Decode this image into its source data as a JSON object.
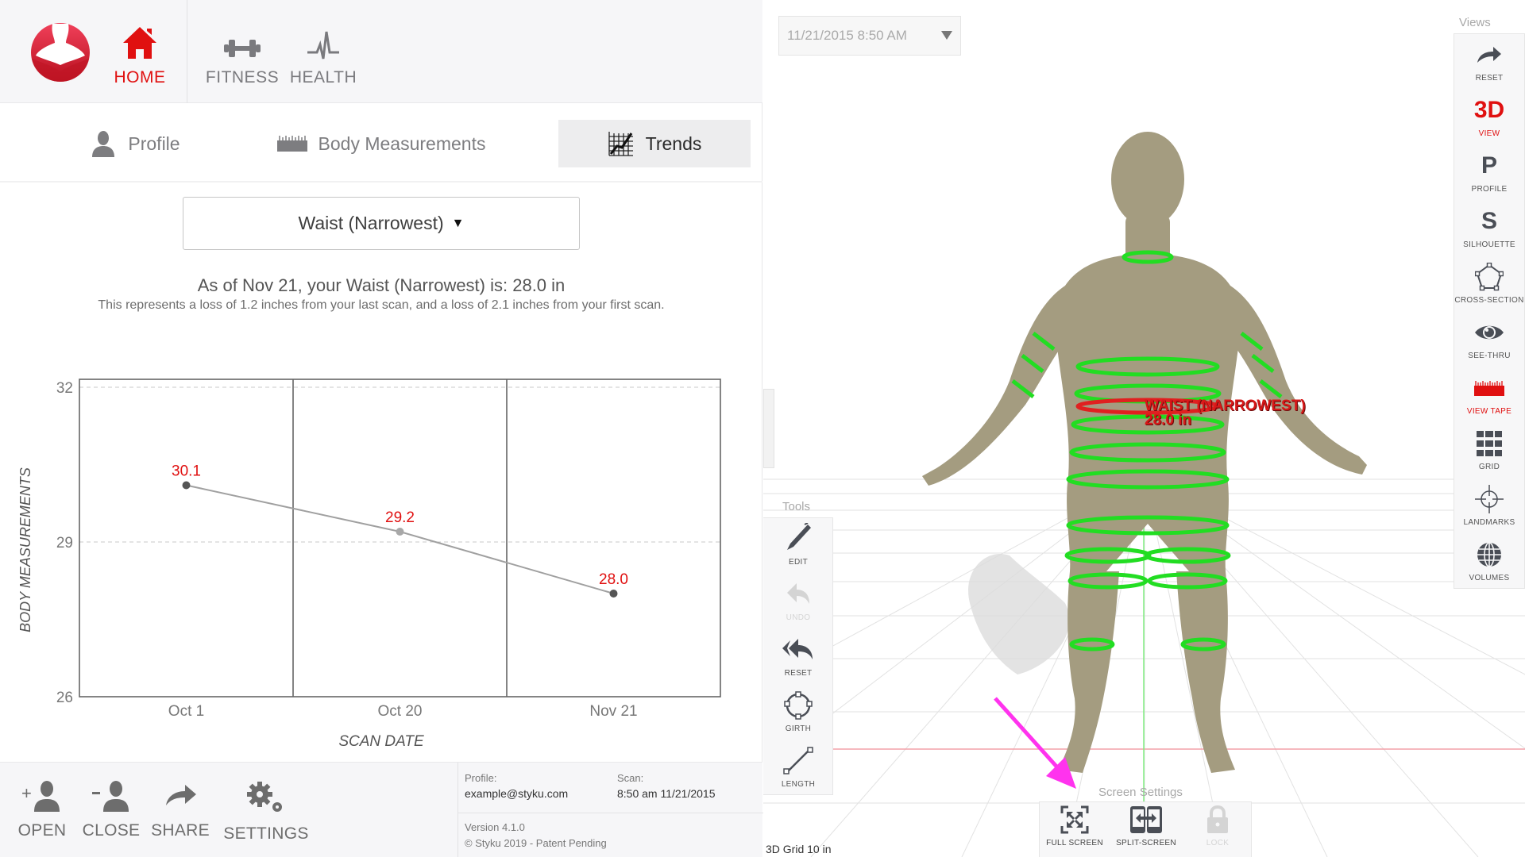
{
  "topnav": {
    "items": [
      {
        "label": "HOME",
        "icon": "home-icon",
        "active": true
      },
      {
        "label": "FITNESS",
        "icon": "dumbbell-icon",
        "active": false
      },
      {
        "label": "HEALTH",
        "icon": "heartbeat-icon",
        "active": false
      }
    ]
  },
  "tabs": [
    {
      "label": "Profile",
      "icon": "person-icon",
      "active": false
    },
    {
      "label": "Body Measurements",
      "icon": "ruler-icon",
      "active": false
    },
    {
      "label": "Trends",
      "icon": "trend-chart-icon",
      "active": true
    }
  ],
  "measure_select": {
    "value": "Waist (Narrowest)",
    "arrow": "▼"
  },
  "summary": {
    "headline": "As of Nov 21, your Waist (Narrowest) is: 28.0 in",
    "subtext": "This represents a loss of 1.2 inches from your last scan, and a loss of 2.1 inches from your first scan."
  },
  "chart_data": {
    "type": "line",
    "title": "",
    "xlabel": "SCAN DATE",
    "ylabel": "BODY MEASUREMENTS",
    "categories": [
      "Oct 1",
      "Oct 20",
      "Nov 21"
    ],
    "values": [
      30.1,
      29.2,
      28.0
    ],
    "data_labels": [
      "30.1",
      "29.2",
      "28.0"
    ],
    "yticks": [
      32,
      29,
      26
    ],
    "ylim": [
      26,
      32
    ],
    "grid": true,
    "label_color": "#e01010",
    "line_color": "#a0a0a0"
  },
  "bottombar": {
    "buttons": [
      {
        "label": "OPEN",
        "icon": "add-user-icon"
      },
      {
        "label": "CLOSE",
        "icon": "remove-user-icon"
      },
      {
        "label": "SHARE",
        "icon": "share-icon"
      },
      {
        "label": "SETTINGS",
        "icon": "gears-icon"
      }
    ],
    "info": {
      "profile_label": "Profile:",
      "profile_value": "example@styku.com",
      "scan_label": "Scan:",
      "scan_value": "8:50 am 11/21/2015",
      "version": "Version 4.1.0",
      "copyright": "© Styku 2019 - Patent Pending"
    }
  },
  "viewport": {
    "scan_select": "11/21/2015 8:50 AM",
    "views_title": "Views",
    "views": [
      {
        "label": "RESET",
        "icon": "redo-arrow-icon",
        "active": false
      },
      {
        "label": "VIEW",
        "icon": "3d-icon",
        "glyph": "3D",
        "active": true
      },
      {
        "label": "PROFILE",
        "icon": "profile-p-icon",
        "glyph": "P",
        "active": false
      },
      {
        "label": "SILHOUETTE",
        "icon": "silhouette-s-icon",
        "glyph": "S",
        "active": false
      },
      {
        "label": "CROSS-SECTION",
        "icon": "pentagon-icon",
        "active": false
      },
      {
        "label": "SEE-THRU",
        "icon": "eye-icon",
        "active": false
      },
      {
        "label": "VIEW TAPE",
        "icon": "tape-measure-icon",
        "active": true
      },
      {
        "label": "GRID",
        "icon": "grid-icon",
        "active": false
      },
      {
        "label": "LANDMARKS",
        "icon": "crosshair-icon",
        "active": false
      },
      {
        "label": "VOLUMES",
        "icon": "globe-icon",
        "active": false
      }
    ],
    "tools_title": "Tools",
    "tools": [
      {
        "label": "EDIT",
        "icon": "pen-icon",
        "disabled": false
      },
      {
        "label": "UNDO",
        "icon": "undo-icon",
        "disabled": true
      },
      {
        "label": "RESET",
        "icon": "reset-all-icon",
        "disabled": false
      },
      {
        "label": "GIRTH",
        "icon": "girth-circle-icon",
        "disabled": false
      },
      {
        "label": "LENGTH",
        "icon": "length-line-icon",
        "disabled": false
      }
    ],
    "screen_settings_title": "Screen Settings",
    "screen_settings": [
      {
        "label": "FULL SCREEN",
        "icon": "fullscreen-icon",
        "disabled": false
      },
      {
        "label": "SPLIT-SCREEN",
        "icon": "split-screen-icon",
        "disabled": false
      },
      {
        "label": "LOCK",
        "icon": "lock-icon",
        "disabled": true
      }
    ],
    "tape_label_name": "WAIST (NARROWEST)",
    "tape_label_value": "28.0 in",
    "grid_label": "3D Grid 10 in",
    "colors": {
      "accent": "#e01010",
      "tape_active": "#e02020",
      "tape_rings": "#22dd22",
      "body": "#a49c80",
      "annotation_arrow": "#ff33ee"
    }
  }
}
